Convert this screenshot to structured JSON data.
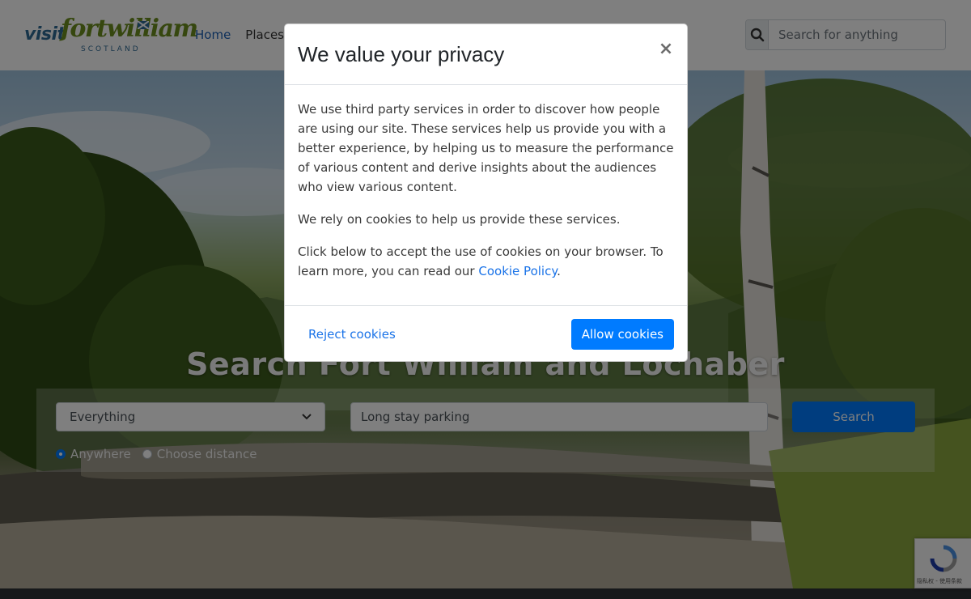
{
  "header": {
    "logo": {
      "visit": "visit",
      "name": "fortwilliam",
      "region": "SCOTLAND"
    },
    "nav": [
      {
        "label": "Home",
        "active": true
      },
      {
        "label": "Places t",
        "active": false
      }
    ],
    "search": {
      "icon": "search-icon",
      "placeholder": "Search for anything"
    }
  },
  "hero": {
    "title": "Search Fort William and Lochaber",
    "category_select": {
      "value": "Everything",
      "icon": "chevron-down-icon"
    },
    "query_input": {
      "value": "Long stay parking"
    },
    "search_button": "Search",
    "location_options": [
      {
        "label": "Anywhere",
        "checked": true
      },
      {
        "label": "Choose distance",
        "checked": false
      }
    ]
  },
  "recaptcha": {
    "icon": "recaptcha-icon",
    "text": "隐私权 - 使用条款"
  },
  "cookie_modal": {
    "title": "We value your privacy",
    "close_icon": "close-icon",
    "paragraph_1": "We use third party services in order to discover how people are using our site. These services help us provide you with a better experience, by helping us to measure the performance of various content and derive insights about the audiences who view various content.",
    "paragraph_2": "We rely on cookies to help us provide these services.",
    "paragraph_3_prefix": "Click below to accept the use of cookies on your browser. To learn more, you can read our ",
    "policy_link": "Cookie Policy",
    "paragraph_3_suffix": ".",
    "reject_label": "Reject cookies",
    "allow_label": "Allow cookies"
  },
  "colors": {
    "primary": "#007bff",
    "link": "#1a73e8",
    "logo_green": "#6d8f1e",
    "logo_blue": "#2f6a94"
  }
}
